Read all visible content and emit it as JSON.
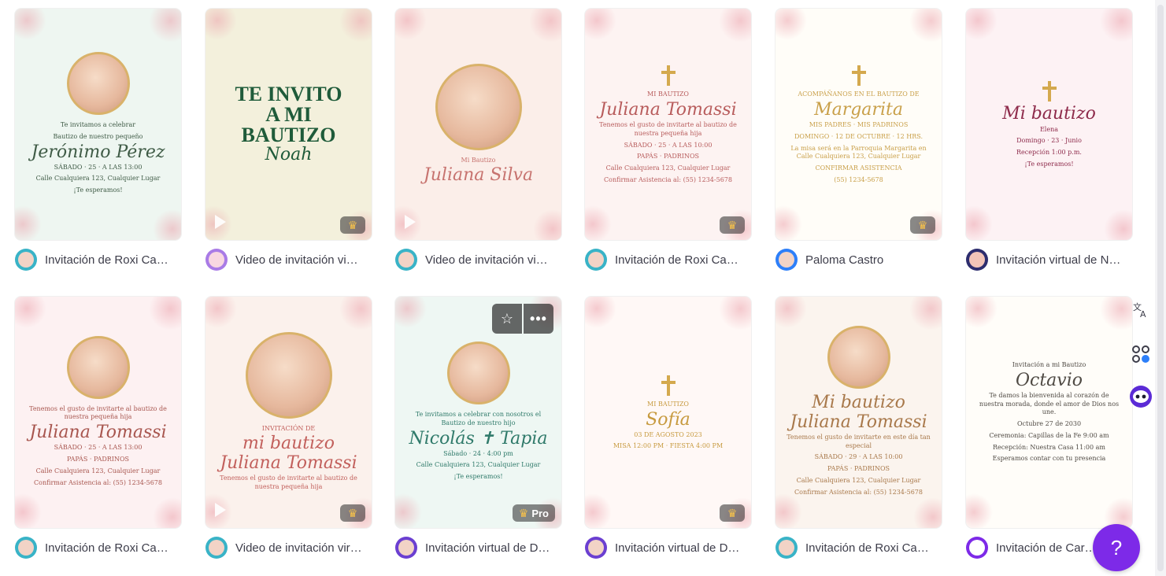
{
  "cards": [
    {
      "id": "c1",
      "author_label": "Invitación de Roxi Ca…",
      "badge": null,
      "video": false,
      "bg": "#eef6f1",
      "accent": "#3f5b46",
      "lines": [
        "Te invitamos a celebrar",
        "Bautizo de nuestro pequeño",
        "Jerónimo Pérez",
        "SÁBADO · 25 · A LAS 13:00",
        "Calle Cualquiera 123, Cualquier Lugar",
        "¡Te esperamos!"
      ]
    },
    {
      "id": "c2",
      "author_label": "Video de invitación vi…",
      "badge": "crown",
      "video": true,
      "bg": "#f3f0dc",
      "accent": "#1f5b3a",
      "lines": [
        "TE INVITO",
        "A MI BAUTIZO",
        "Noah"
      ]
    },
    {
      "id": "c3",
      "author_label": "Video de invitación vi…",
      "badge": null,
      "video": true,
      "bg": "#fbeee9",
      "accent": "#c7736f",
      "lines": [
        "Mi Bautizo",
        "Juliana Silva"
      ]
    },
    {
      "id": "c4",
      "author_label": "Invitación de Roxi Ca…",
      "badge": "crown",
      "video": false,
      "bg": "#fdf3f2",
      "accent": "#b85c5c",
      "lines": [
        "MI BAUTIZO",
        "Juliana Tomassi",
        "Tenemos el gusto de invitarte al bautizo de nuestra pequeña hija",
        "SÁBADO · 25 · A LAS 10:00",
        "PAPÁS · PADRINOS",
        "Calle Cualquiera 123, Cualquier Lugar",
        "Confirmar Asistencia al: (55) 1234-5678"
      ]
    },
    {
      "id": "c5",
      "author_label": "Paloma Castro",
      "badge": "crown",
      "video": false,
      "bg": "#fffdf8",
      "accent": "#c9a04a",
      "lines": [
        "ACOMPÁÑANOS EN EL BAUTIZO DE",
        "Margarita",
        "MIS PADRES · MIS PADRINOS",
        "DOMINGO · 12 DE OCTUBRE · 12 HRS.",
        "La misa será en la Parroquia Margarita en Calle Cualquiera 123, Cualquier Lugar",
        "CONFIRMAR ASISTENCIA",
        "(55) 1234-5678"
      ]
    },
    {
      "id": "c6",
      "author_label": "Invitación virtual de N…",
      "badge": null,
      "video": false,
      "bg": "#fdf2f4",
      "accent": "#8e2b4b",
      "lines": [
        "Mi bautizo",
        "Elena",
        "Domingo · 23 · Junio",
        "Recepción 1:00 p.m.",
        "¡Te esperamos!"
      ]
    },
    {
      "id": "c7",
      "author_label": "Invitación de Roxi Ca…",
      "badge": null,
      "video": false,
      "bg": "#fdf1f2",
      "accent": "#a8564f",
      "lines": [
        "Tenemos el gusto de invitarte al bautizo de nuestra pequeña hija",
        "Juliana Tomassi",
        "SÁBADO · 25 · A LAS 13:00",
        "PAPÁS · PADRINOS",
        "Calle Cualquiera 123, Cualquier Lugar",
        "Confirmar Asistencia al: (55) 1234-5678"
      ]
    },
    {
      "id": "c8",
      "author_label": "Video de invitación vir…",
      "badge": "crown",
      "video": true,
      "bg": "#fbf1ec",
      "accent": "#c2605c",
      "lines": [
        "INVITACIÓN DE",
        "mi bautizo",
        "Juliana Tomassi",
        "Tenemos el gusto de invitarte al bautizo de nuestra pequeña hija"
      ]
    },
    {
      "id": "c9",
      "author_label": "Invitación virtual de D…",
      "badge": "pro",
      "video": false,
      "bg": "#eef7f3",
      "accent": "#2f7a6a",
      "lines": [
        "Te invitamos a celebrar con nosotros el Bautizo de nuestro hijo",
        "Nicolás ✝ Tapia",
        "Sábado · 24 · 4:00 pm",
        "Calle Cualquiera 123, Cualquier Lugar",
        "¡Te esperamos!"
      ]
    },
    {
      "id": "c10",
      "author_label": "Invitación virtual de D…",
      "badge": "crown",
      "video": false,
      "bg": "#fff8f6",
      "accent": "#c79a3f",
      "lines": [
        "MI BAUTIZO",
        "Sofía",
        "03 DE AGOSTO 2023",
        "MISA 12:00 PM · FIESTA 4:00 PM"
      ]
    },
    {
      "id": "c11",
      "author_label": "Invitación de Roxi Ca…",
      "badge": null,
      "video": false,
      "bg": "#fbf4ee",
      "accent": "#a8784a",
      "lines": [
        "Mi bautizo",
        "Juliana Tomassi",
        "Tenemos el gusto de invitarte en este día tan especial",
        "SÁBADO · 29 · A LAS 10:00",
        "PAPÁS · PADRINOS",
        "Calle Cualquiera 123, Cualquier Lugar",
        "Confirmar Asistencia al: (55) 1234-5678"
      ]
    },
    {
      "id": "c12",
      "author_label": "Invitación de Car…",
      "badge": null,
      "video": false,
      "bg": "#fffdf9",
      "accent": "#4f4a44",
      "lines": [
        "Invitación a mi Bautizo",
        "Octavio",
        "Te damos la bienvenida al corazón de nuestra morada, donde el amor de Dios nos une.",
        "Octubre 27 de 2030",
        "Ceremonia: Capillas de la Fe 9:00 am",
        "Recepción: Nuestra Casa 11:00 am",
        "Esperamos contar con tu presencia"
      ]
    }
  ],
  "hover_card": "c9",
  "icons": {
    "crown": "crown-icon",
    "play": "play-icon",
    "star": "star-icon",
    "more": "more-icon",
    "translate": "translate-icon",
    "apps": "apps-icon",
    "assistant": "assistant-icon",
    "help": "help-icon"
  },
  "help_label": "?",
  "colors": {
    "brand_purple": "#7d2ae8",
    "crown_gold": "#f6c14b"
  }
}
